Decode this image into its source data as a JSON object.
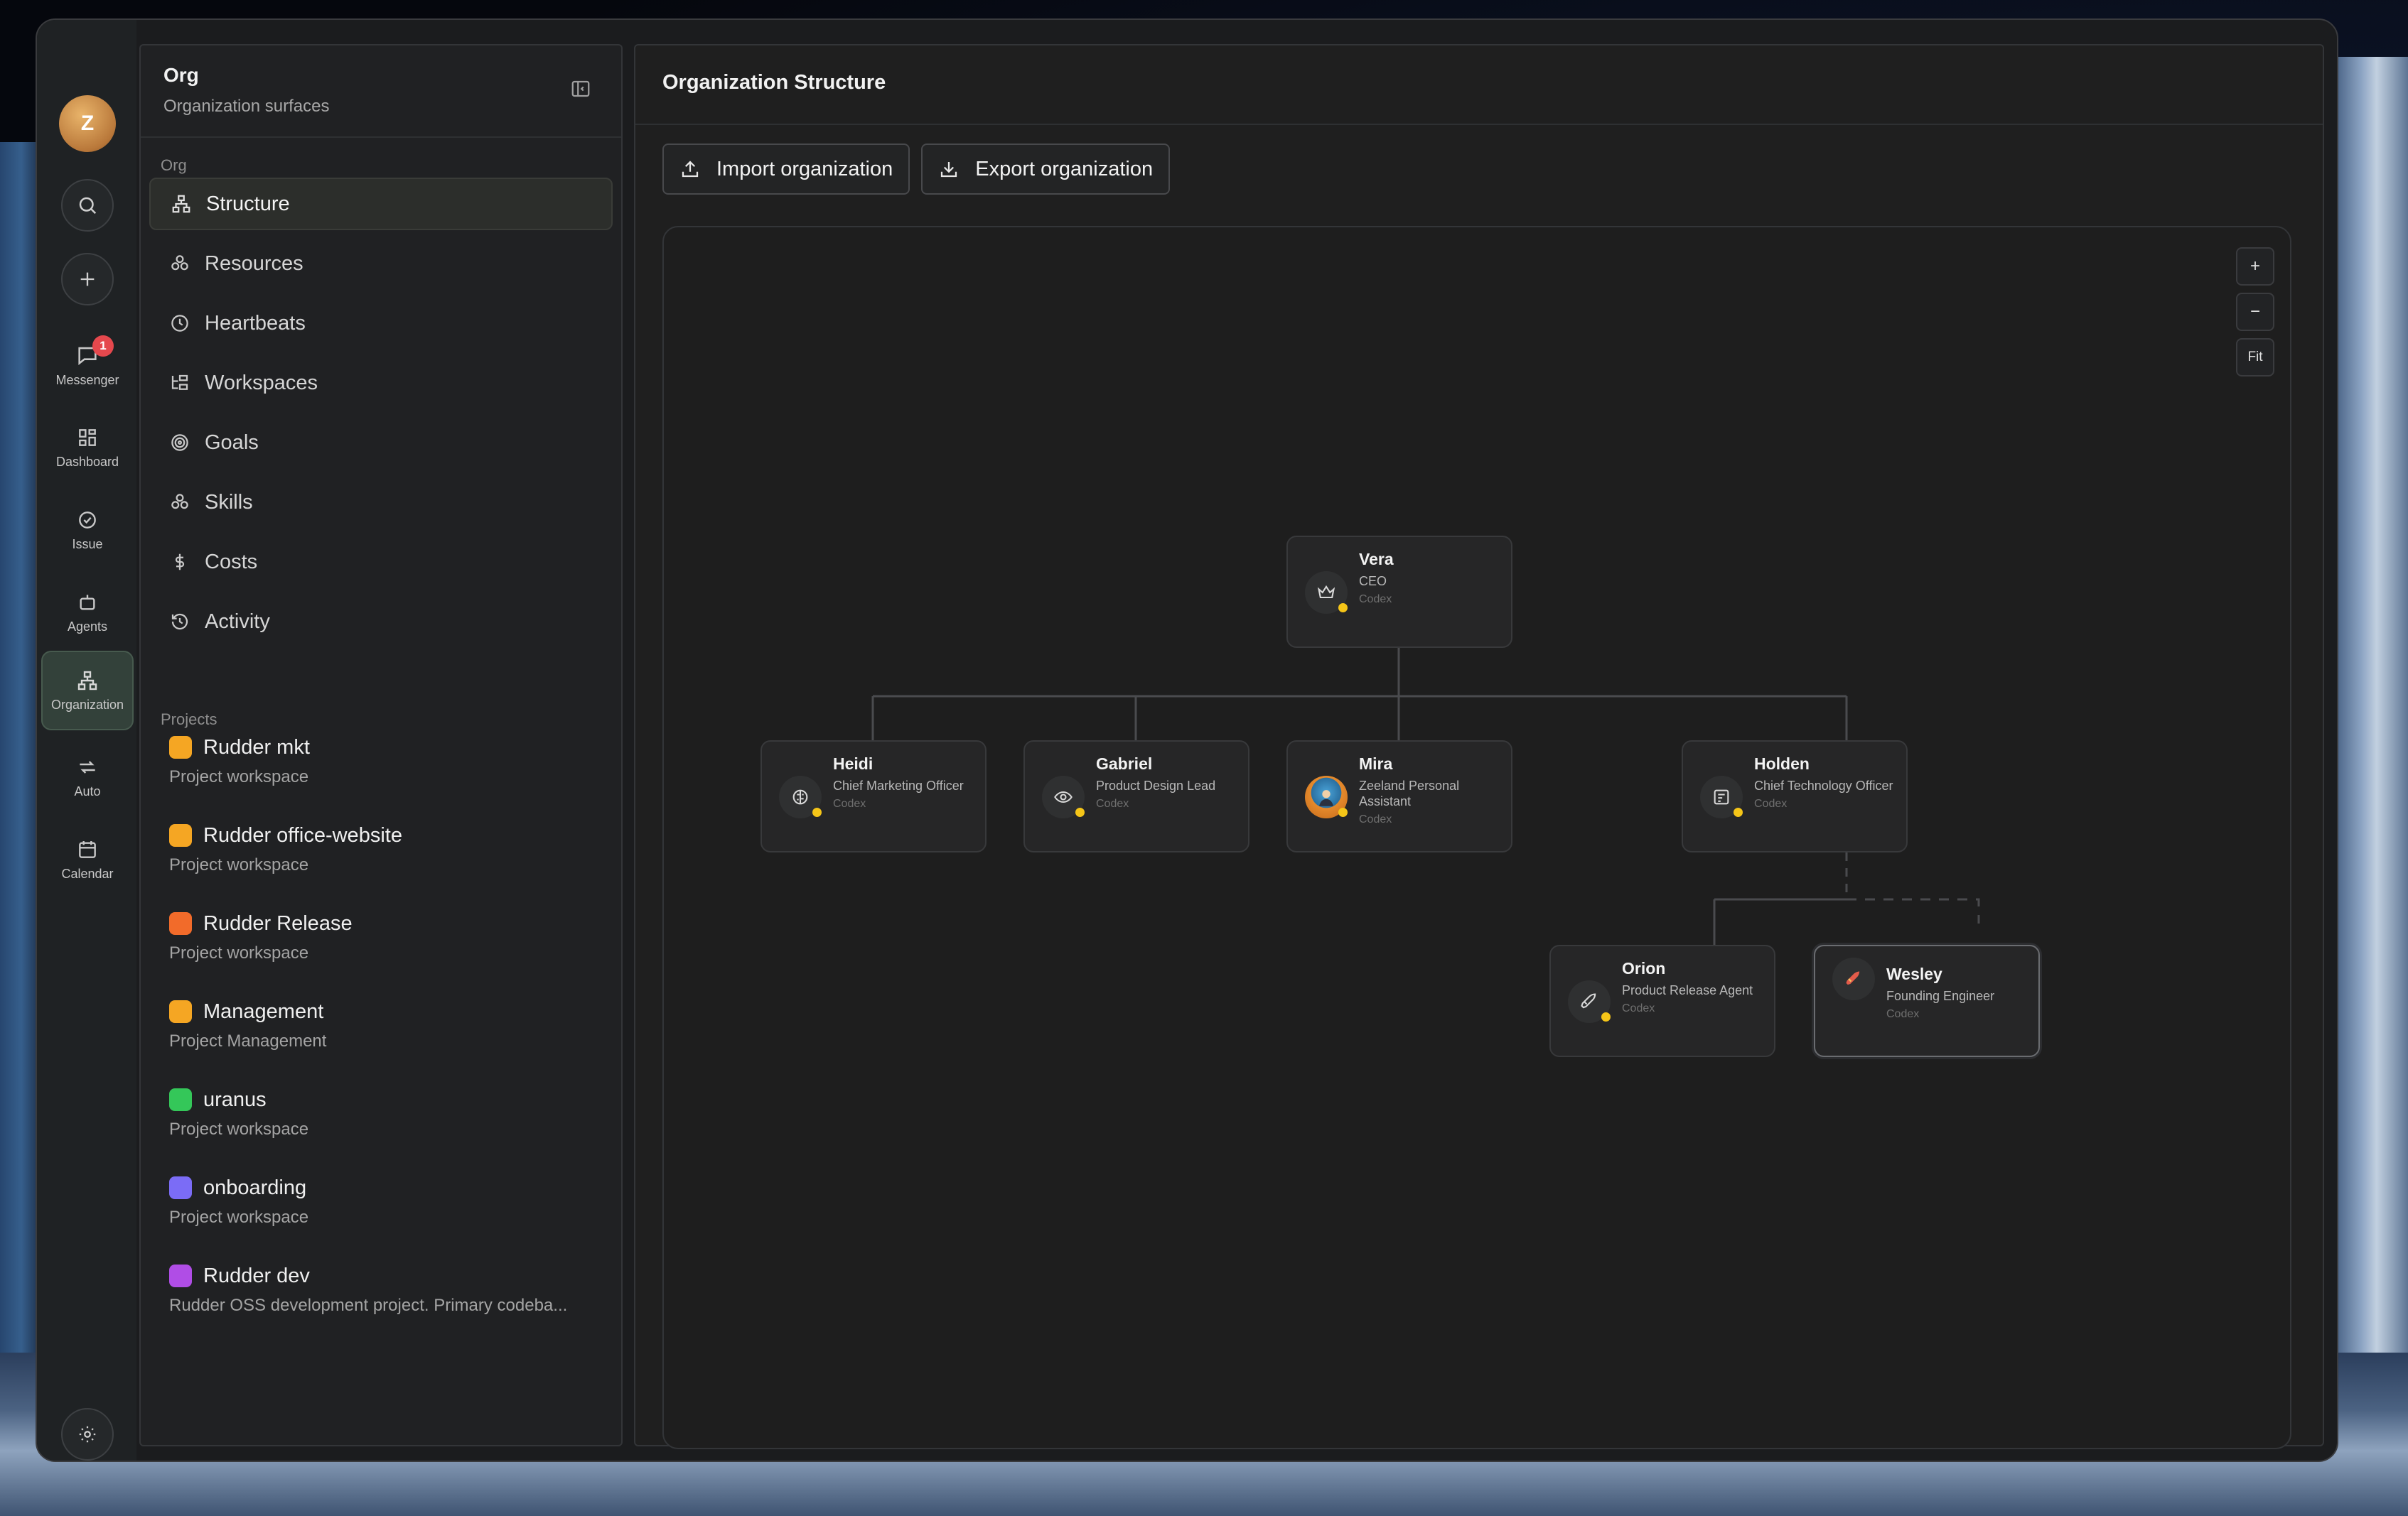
{
  "rail": {
    "avatar_letter": "Z",
    "messenger": {
      "label": "Messenger",
      "badge": "1"
    },
    "dashboard": "Dashboard",
    "issue": "Issue",
    "agents": "Agents",
    "organization": "Organization",
    "auto": "Auto",
    "calendar": "Calendar"
  },
  "sidebar": {
    "title": "Org",
    "subtitle": "Organization surfaces",
    "section_org": "Org",
    "nav": [
      "Structure",
      "Resources",
      "Heartbeats",
      "Workspaces",
      "Goals",
      "Skills",
      "Costs",
      "Activity"
    ],
    "section_projects": "Projects",
    "projects": [
      {
        "name": "Rudder mkt",
        "sub": "Project workspace",
        "color": "#f5a623"
      },
      {
        "name": "Rudder office-website",
        "sub": "Project workspace",
        "color": "#f5a623"
      },
      {
        "name": "Rudder Release",
        "sub": "Project workspace",
        "color": "#f26b2a"
      },
      {
        "name": "Management",
        "sub": "Project Management",
        "color": "#f5a623"
      },
      {
        "name": "uranus",
        "sub": "Project workspace",
        "color": "#34c759"
      },
      {
        "name": "onboarding",
        "sub": "Project workspace",
        "color": "#7b6cf6"
      },
      {
        "name": "Rudder dev",
        "sub": "Rudder OSS development project. Primary codeba...",
        "color": "#b04de6"
      }
    ]
  },
  "main": {
    "title": "Organization Structure",
    "import_label": "Import organization",
    "export_label": "Export organization",
    "zoom_in": "+",
    "zoom_out": "−",
    "fit": "Fit"
  },
  "org": {
    "vera": {
      "name": "Vera",
      "role": "CEO",
      "runtime": "Codex",
      "icon": "crown-icon"
    },
    "heidi": {
      "name": "Heidi",
      "role": "Chief Marketing Officer",
      "runtime": "Codex",
      "icon": "brain-icon"
    },
    "gabriel": {
      "name": "Gabriel",
      "role": "Product Design Lead",
      "runtime": "Codex",
      "icon": "eye-icon"
    },
    "mira": {
      "name": "Mira",
      "role": "Zeeland Personal Assistant",
      "runtime": "Codex",
      "icon": "avatar-image"
    },
    "holden": {
      "name": "Holden",
      "role": "Chief Technology Officer",
      "runtime": "Codex",
      "icon": "code-icon"
    },
    "orion": {
      "name": "Orion",
      "role": "Product Release Agent",
      "runtime": "Codex",
      "icon": "rocket-icon"
    },
    "wesley": {
      "name": "Wesley",
      "role": "Founding Engineer",
      "runtime": "Codex",
      "icon": "rocket-icon"
    },
    "status_color": "#f5c518"
  }
}
